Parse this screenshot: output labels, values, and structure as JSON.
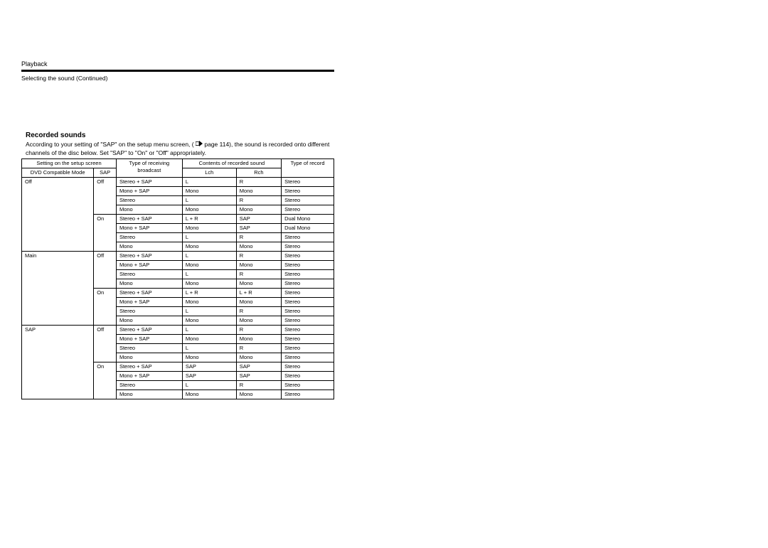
{
  "header": {
    "category": "Playback",
    "subheading": "Selecting the sound (Continued)"
  },
  "section": {
    "title": "Recorded sounds",
    "body_line1_a": "According to your setting of \"SAP\" on the setup menu screen, (",
    "body_line1_b": " page 114), the sound is recorded onto different",
    "body_line2": "channels of the disc below. Set \"SAP\" to \"On\" or \"Off\" appropriately."
  },
  "table": {
    "headers": {
      "setting_group": "Setting on the setup screen",
      "dvd_mode": "DVD Compatible Mode",
      "sap": "SAP",
      "type_broadcast": "Type of receiving broadcast",
      "contents_group": "Contents of recorded sound",
      "lch": "Lch",
      "rch": "Rch",
      "type_record": "Type of record"
    },
    "groups": [
      {
        "mode": "Off",
        "subs": [
          {
            "sap": "Off",
            "rows": [
              {
                "b": "Stereo + SAP",
                "l": "L",
                "r": "R",
                "t": "Stereo"
              },
              {
                "b": "Mono + SAP",
                "l": "Mono",
                "r": "Mono",
                "t": "Stereo"
              },
              {
                "b": "Stereo",
                "l": "L",
                "r": "R",
                "t": "Stereo"
              },
              {
                "b": "Mono",
                "l": "Mono",
                "r": "Mono",
                "t": "Stereo"
              }
            ]
          },
          {
            "sap": "On",
            "rows": [
              {
                "b": "Stereo + SAP",
                "l": "L + R",
                "r": "SAP",
                "t": "Dual Mono"
              },
              {
                "b": "Mono + SAP",
                "l": "Mono",
                "r": "SAP",
                "t": "Dual Mono"
              },
              {
                "b": "Stereo",
                "l": "L",
                "r": "R",
                "t": "Stereo"
              },
              {
                "b": "Mono",
                "l": "Mono",
                "r": "Mono",
                "t": "Stereo"
              }
            ]
          }
        ]
      },
      {
        "mode": "Main",
        "subs": [
          {
            "sap": "Off",
            "rows": [
              {
                "b": "Stereo + SAP",
                "l": "L",
                "r": "R",
                "t": "Stereo"
              },
              {
                "b": "Mono + SAP",
                "l": "Mono",
                "r": "Mono",
                "t": "Stereo"
              },
              {
                "b": "Stereo",
                "l": "L",
                "r": "R",
                "t": "Stereo"
              },
              {
                "b": "Mono",
                "l": "Mono",
                "r": "Mono",
                "t": "Stereo"
              }
            ]
          },
          {
            "sap": "On",
            "rows": [
              {
                "b": "Stereo + SAP",
                "l": "L + R",
                "r": "L + R",
                "t": "Stereo"
              },
              {
                "b": "Mono + SAP",
                "l": "Mono",
                "r": "Mono",
                "t": "Stereo"
              },
              {
                "b": "Stereo",
                "l": "L",
                "r": "R",
                "t": "Stereo"
              },
              {
                "b": "Mono",
                "l": "Mono",
                "r": "Mono",
                "t": "Stereo"
              }
            ]
          }
        ]
      },
      {
        "mode": "SAP",
        "subs": [
          {
            "sap": "Off",
            "rows": [
              {
                "b": "Stereo + SAP",
                "l": "L",
                "r": "R",
                "t": "Stereo"
              },
              {
                "b": "Mono + SAP",
                "l": "Mono",
                "r": "Mono",
                "t": "Stereo"
              },
              {
                "b": "Stereo",
                "l": "L",
                "r": "R",
                "t": "Stereo"
              },
              {
                "b": "Mono",
                "l": "Mono",
                "r": "Mono",
                "t": "Stereo"
              }
            ]
          },
          {
            "sap": "On",
            "rows": [
              {
                "b": "Stereo + SAP",
                "l": "SAP",
                "r": "SAP",
                "t": "Stereo"
              },
              {
                "b": "Mono + SAP",
                "l": "SAP",
                "r": "SAP",
                "t": "Stereo"
              },
              {
                "b": "Stereo",
                "l": "L",
                "r": "R",
                "t": "Stereo"
              },
              {
                "b": "Mono",
                "l": "Mono",
                "r": "Mono",
                "t": "Stereo"
              }
            ]
          }
        ]
      }
    ]
  }
}
